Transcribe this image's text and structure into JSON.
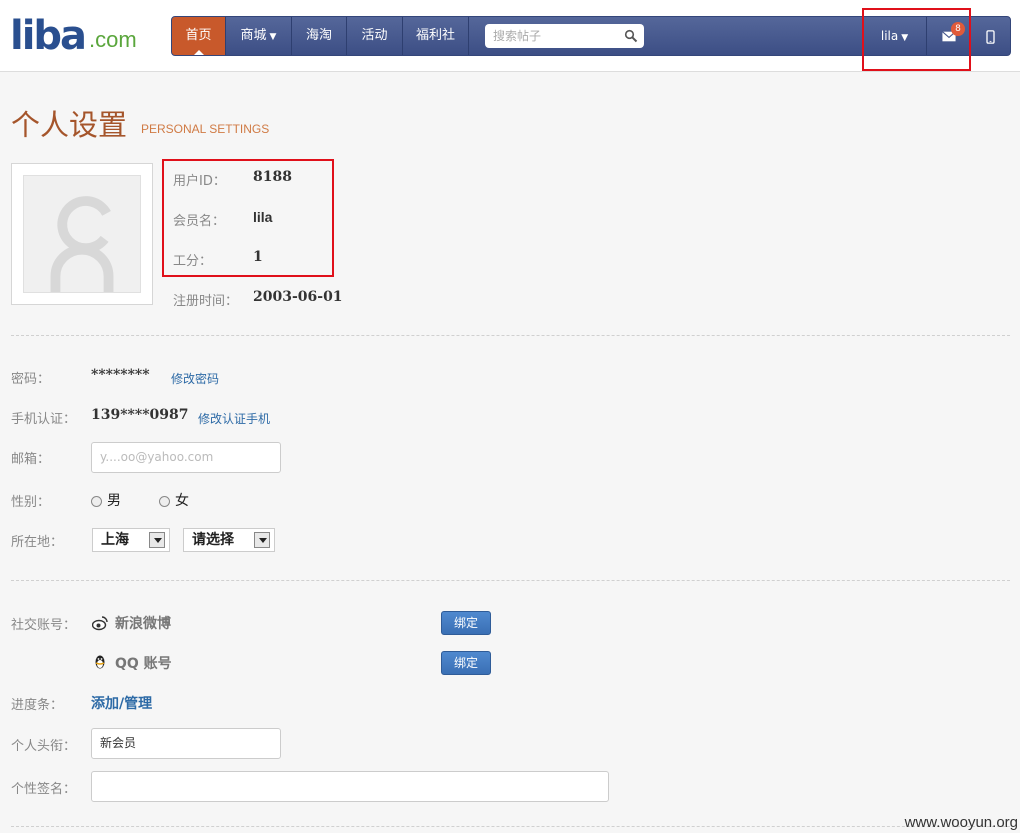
{
  "brand": {
    "logo_main": "liba",
    "logo_tld": ".com"
  },
  "nav": {
    "items": [
      {
        "label": "首页",
        "active": true
      },
      {
        "label": "商城",
        "dropdown": true
      },
      {
        "label": "海淘"
      },
      {
        "label": "活动"
      },
      {
        "label": "福利社"
      }
    ],
    "search_placeholder": "搜索帖子",
    "user_menu": "lila",
    "message_count": "8"
  },
  "page": {
    "title": "个人设置",
    "subtitle": "PERSONAL SETTINGS"
  },
  "profile": {
    "user_id_label": "用户ID：",
    "user_id": "8188",
    "nickname_label": "会员名：",
    "nickname": "lila",
    "points_label": "工分：",
    "points": "1",
    "register_label": "注册时间：",
    "register_date": "2003-06-01"
  },
  "settings": {
    "password_label": "密码：",
    "password_value": "********",
    "password_link": "修改密码",
    "phone_label": "手机认证：",
    "phone_value": "139****0987",
    "phone_link": "修改认证手机",
    "email_label": "邮箱：",
    "email_value": "y....oo@yahoo.com",
    "gender_label": "性别：",
    "gender_male": "男",
    "gender_female": "女",
    "location_label": "所在地：",
    "location_province": "上海",
    "location_city": "请选择"
  },
  "social": {
    "label": "社交账号：",
    "weibo_name": "新浪微博",
    "qq_name": "QQ 账号",
    "bind_label": "绑定",
    "progress_label": "进度条：",
    "progress_link": "添加/管理",
    "title_label": "个人头衔：",
    "title_value": "新会员",
    "signature_label": "个性签名：",
    "signature_value": ""
  },
  "watermark": "www.wooyun.org",
  "colors": {
    "accent": "#c8592b",
    "nav_bg": "#45578c",
    "highlight_box": "#e0101a",
    "link": "#2d6aa6"
  }
}
